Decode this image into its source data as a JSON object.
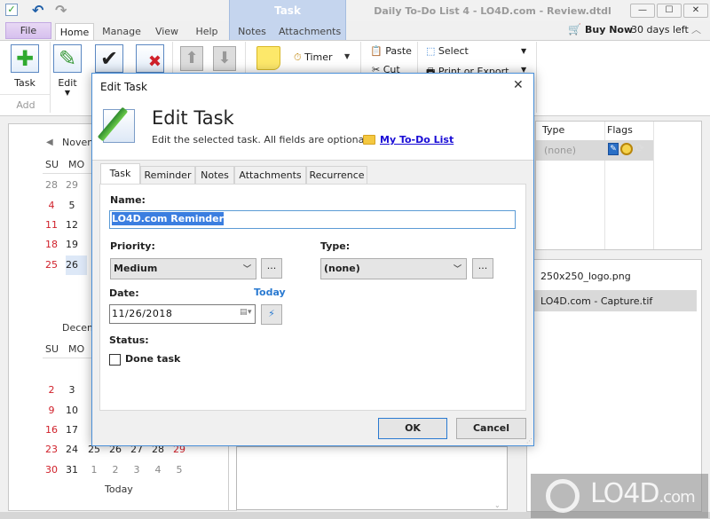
{
  "window": {
    "title": "Daily To-Do List 4 - LO4D.com - Review.dtdl",
    "minimize": "—",
    "maximize": "☐",
    "close": "✕"
  },
  "quick_access": {
    "undo": "↶",
    "redo": "↷"
  },
  "ribbon": {
    "context_tab_group": "Task",
    "tabs": [
      "File",
      "Home",
      "Manage",
      "View",
      "Help",
      "Notes",
      "Attachments"
    ],
    "buy_now": "Buy Now",
    "days_left": "30 days left",
    "collapse": "︿",
    "buttons": {
      "task": "Task",
      "edit": "Edit",
      "timer": "Timer",
      "paste": "Paste",
      "cut": "Cut",
      "select": "Select",
      "print_export": "Print or Export..."
    },
    "groups": {
      "add": "Add"
    }
  },
  "calendar": {
    "november": {
      "title": "Novem",
      "headers": [
        "SU",
        "MO"
      ],
      "rows": [
        [
          "28",
          "29"
        ],
        [
          "4",
          "5"
        ],
        [
          "11",
          "12"
        ],
        [
          "18",
          "19"
        ],
        [
          "25",
          "26"
        ]
      ]
    },
    "december": {
      "title": "Decem",
      "headers": [
        "SU",
        "MO"
      ],
      "rows": [
        [
          "2",
          "3"
        ],
        [
          "9",
          "10"
        ],
        [
          "16",
          "17"
        ],
        [
          "23",
          "24",
          "25",
          "26",
          "27",
          "28",
          "29"
        ],
        [
          "30",
          "31",
          "1",
          "2",
          "3",
          "4",
          "5"
        ]
      ]
    },
    "today_label": "Today"
  },
  "task_grid": {
    "columns": [
      "Type",
      "Flags"
    ],
    "rows": [
      {
        "type": "(none)"
      }
    ]
  },
  "attachments": {
    "files": [
      "250x250_logo.png",
      "LO4D.com - Capture.tif"
    ]
  },
  "dialog": {
    "window_title": "Edit Task",
    "heading": "Edit Task",
    "subtitle": "Edit the selected task. All fields are optional.",
    "list_link": "My To-Do List",
    "tabs": [
      "Task",
      "Reminder",
      "Notes",
      "Attachments",
      "Recurrence"
    ],
    "name_label": "Name:",
    "name_value": "LO4D.com Reminder",
    "priority_label": "Priority:",
    "priority_value": "Medium",
    "type_label": "Type:",
    "type_value": "(none)",
    "ellipsis": "...",
    "date_label": "Date:",
    "today_link": "Today",
    "date_value": "11/26/2018",
    "status_label": "Status:",
    "done_label": "Done task",
    "done_checked": false,
    "ok": "OK",
    "cancel": "Cancel"
  },
  "watermark": {
    "text": "LO4D",
    "suffix": ".com"
  }
}
